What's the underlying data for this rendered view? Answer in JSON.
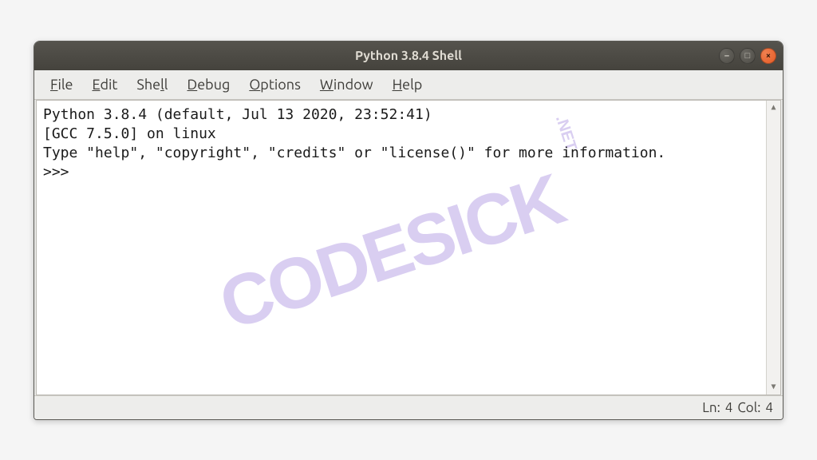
{
  "window": {
    "title": "Python 3.8.4 Shell"
  },
  "menu": {
    "file": "File",
    "edit": "Edit",
    "shell": "Shell",
    "debug": "Debug",
    "options": "Options",
    "window": "Window",
    "help": "Help"
  },
  "shell": {
    "line1": "Python 3.8.4 (default, Jul 13 2020, 23:52:41)",
    "line2": "[GCC 7.5.0] on linux",
    "line3": "Type \"help\", \"copyright\", \"credits\" or \"license()\" for more information.",
    "prompt": ">>> "
  },
  "watermark": {
    "main": "CODESICK",
    "sub": ".NET"
  },
  "status": {
    "ln_label": "Ln:",
    "ln_value": "4",
    "col_label": "Col:",
    "col_value": "4"
  }
}
